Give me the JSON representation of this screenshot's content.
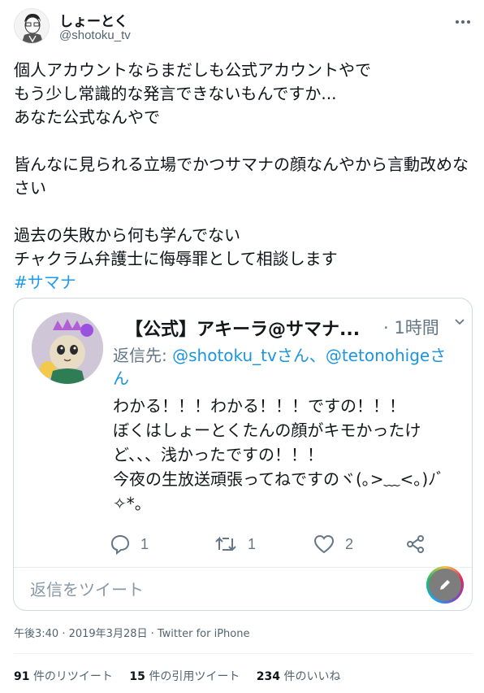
{
  "author": {
    "display_name": "しょーとく",
    "handle": "@shotoku_tv",
    "more_icon": "ellipsis-icon"
  },
  "tweet": {
    "text": "個人アカウントならまだしも公式アカウントやで\nもう少し常識的な発言できないもんですか...\nあなた公式なんやで\n\n皆んなに見られる立場でかつサマナの顔なんやから言動改めなさい\n\n過去の失敗から何も学んでない\nチャクラム弁護士に侮辱罪として相談します",
    "hashtag": "#サマナ"
  },
  "quoted": {
    "name": "【公式】アキーラ@サマナ...",
    "time": "· 1時間",
    "reply_prefix": "返信先: ",
    "mentions": "@shotoku_tvさん、@tetonohigeさん",
    "body": "わかる！！！わかる！！！ですの！！！\nぼくはしょーとくたんの顔がキモかったけど、、、浅かったですの！！！\n今夜の生放送頑張ってねですのヾ(｡>﹏<｡)ﾉﾞ✧*。",
    "reply_count": "1",
    "retweet_count": "1",
    "like_count": "2",
    "reply_placeholder": "返信をツイート"
  },
  "meta": {
    "timestamp": "午後3:40 · 2019年3月28日 · Twitter for iPhone"
  },
  "stats": {
    "retweets": "91",
    "retweets_label": "件のリツイート",
    "quotes": "15",
    "quotes_label": "件の引用ツイート",
    "likes": "234",
    "likes_label": "件のいいね"
  },
  "colors": {
    "link": "#1d9bf0",
    "secondary_text": "#536471",
    "border": "#cfd9de"
  }
}
